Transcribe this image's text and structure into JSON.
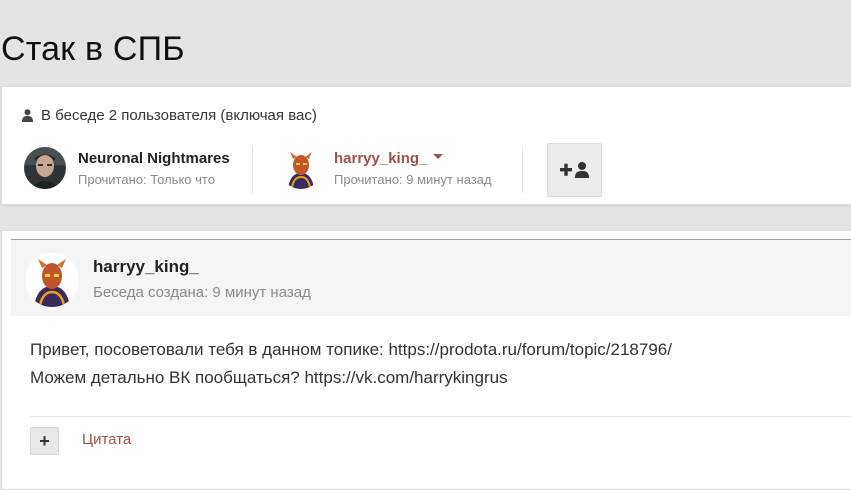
{
  "page": {
    "title": "Стак в СПБ"
  },
  "participants": {
    "header": "В беседе 2 пользователя (включая вас)",
    "members": [
      {
        "name": "Neuronal Nightmares",
        "status": "Прочитано: Только что",
        "avatar_icon": "avatar-photo"
      },
      {
        "name": "harryy_king_",
        "status": "Прочитано: 9 минут назад",
        "avatar_icon": "avatar-hero"
      }
    ],
    "invite_icon": "plus-user-icon"
  },
  "message": {
    "author": "harryy_king_",
    "created": "Беседа создана: 9 минут назад",
    "lines": [
      "Привет, посоветовали тебя в данном топике: https://prodota.ru/forum/topic/218796/",
      "Можем детально ВК пообщаться? https://vk.com/harrykingrus"
    ],
    "plus_label": "+",
    "quote_label": "Цитата"
  },
  "colors": {
    "accent": "#a24f4f",
    "muted": "#8a8a8a",
    "background": "#e4e4e4"
  }
}
